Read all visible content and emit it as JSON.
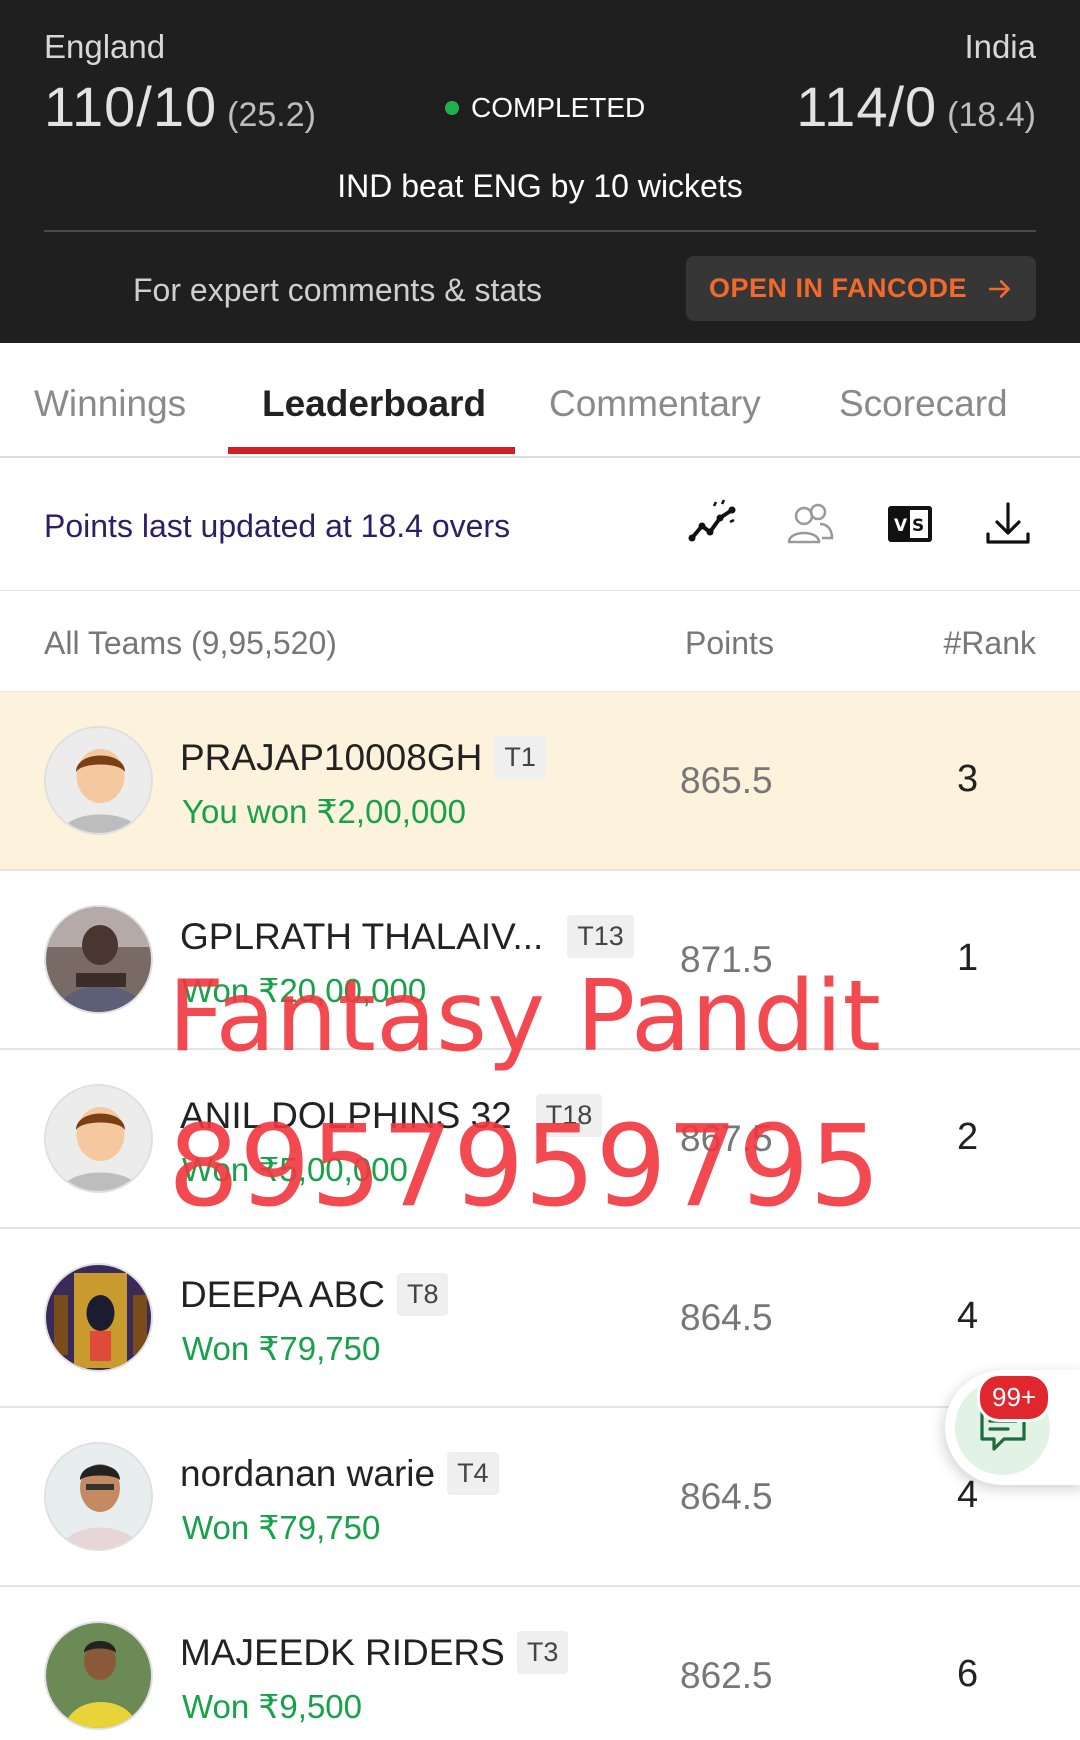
{
  "match": {
    "team_left": "England",
    "score_left": "110/10",
    "overs_left": "(25.2)",
    "team_right": "India",
    "score_right": "114/0",
    "overs_right": "(18.4)",
    "status": "COMPLETED",
    "result": "IND beat ENG by 10 wickets",
    "expert_text": "For expert comments & stats",
    "open_button": "OPEN IN FANCODE"
  },
  "tabs": [
    {
      "label": "Winnings"
    },
    {
      "label": "Leaderboard"
    },
    {
      "label": "Commentary"
    },
    {
      "label": "Scorecard"
    }
  ],
  "info": {
    "points_updated": "Points last updated at 18.4 overs"
  },
  "columns": {
    "teams": "All Teams (9,95,520)",
    "points": "Points",
    "rank": "#Rank"
  },
  "rows": [
    {
      "name": "PRAJAP10008GH",
      "tag": "T1",
      "winnings": "You won ₹2,00,000",
      "points": "865.5",
      "rank": "3"
    },
    {
      "name": "GPLRATH THALAIV...",
      "tag": "T13",
      "winnings": "Won ₹20,00,000",
      "points": "871.5",
      "rank": "1"
    },
    {
      "name": "ANIL DOLPHINS 32",
      "tag": "T18",
      "winnings": "Won ₹5,00,000",
      "points": "867.5",
      "rank": "2"
    },
    {
      "name": "DEEPA ABC",
      "tag": "T8",
      "winnings": "Won ₹79,750",
      "points": "864.5",
      "rank": "4"
    },
    {
      "name": "nordanan warie",
      "tag": "T4",
      "winnings": "Won ₹79,750",
      "points": "864.5",
      "rank": "4"
    },
    {
      "name": "MAJEEDK RIDERS",
      "tag": "T3",
      "winnings": "Won ₹9,500",
      "points": "862.5",
      "rank": "6"
    }
  ],
  "watermark": {
    "line1": "Fantasy Pandit",
    "line2": "8957959795"
  },
  "chat": {
    "badge": "99+"
  },
  "colors": {
    "header_bg": "#1f1f1f",
    "accent_orange": "#f16a2b",
    "tab_underline": "#d51f26",
    "win_green": "#17a24a",
    "highlight_row": "#fdf2dc",
    "watermark_red": "#f2363f"
  }
}
